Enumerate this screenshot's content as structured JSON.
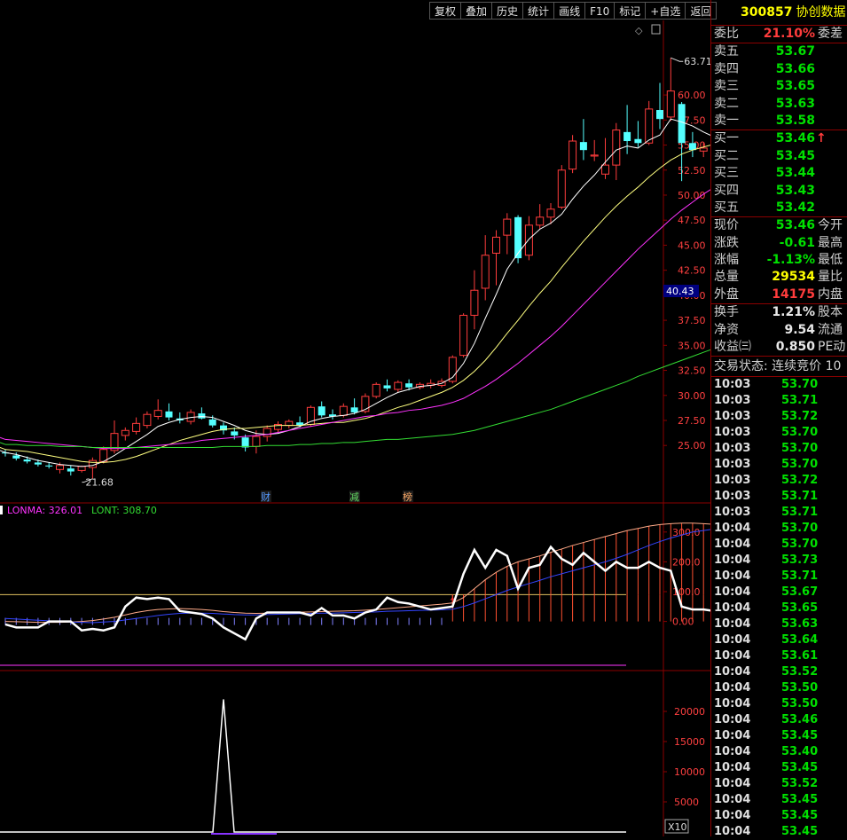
{
  "toolbar": [
    "复权",
    "叠加",
    "历史",
    "统计",
    "画线",
    "F10",
    "标记",
    "+自选",
    "返回"
  ],
  "stock": {
    "code": "300857",
    "name": "协创数据"
  },
  "order_ratio": {
    "label": "委比",
    "value": "21.10%",
    "label2": "委差"
  },
  "asks": [
    {
      "label": "卖五",
      "price": "53.67"
    },
    {
      "label": "卖四",
      "price": "53.66"
    },
    {
      "label": "卖三",
      "price": "53.65"
    },
    {
      "label": "卖二",
      "price": "53.63"
    },
    {
      "label": "卖一",
      "price": "53.58"
    }
  ],
  "bids": [
    {
      "label": "买一",
      "price": "53.46",
      "arrow": "↑"
    },
    {
      "label": "买二",
      "price": "53.45"
    },
    {
      "label": "买三",
      "price": "53.44"
    },
    {
      "label": "买四",
      "price": "53.43"
    },
    {
      "label": "买五",
      "price": "53.42"
    }
  ],
  "quote": [
    {
      "label": "现价",
      "value": "53.46",
      "label2": "今开",
      "color": "green"
    },
    {
      "label": "涨跌",
      "value": "-0.61",
      "label2": "最高",
      "color": "green"
    },
    {
      "label": "涨幅",
      "value": "-1.13%",
      "label2": "最低",
      "color": "green"
    },
    {
      "label": "总量",
      "value": "29534",
      "label2": "量比",
      "color": "yellow"
    },
    {
      "label": "外盘",
      "value": "14175",
      "label2": "内盘",
      "color": "red"
    }
  ],
  "fund": [
    {
      "label": "换手",
      "value": "1.21%",
      "label2": "股本"
    },
    {
      "label": "净资",
      "value": "9.54",
      "label2": "流通"
    },
    {
      "label": "收益㈢",
      "value": "0.850",
      "label2": "PE动"
    }
  ],
  "trade_status": "交易状态: 连续竞价 10",
  "ticks": [
    {
      "t": "10:03",
      "p": "53.70"
    },
    {
      "t": "10:03",
      "p": "53.71"
    },
    {
      "t": "10:03",
      "p": "53.72"
    },
    {
      "t": "10:03",
      "p": "53.70"
    },
    {
      "t": "10:03",
      "p": "53.70"
    },
    {
      "t": "10:03",
      "p": "53.70"
    },
    {
      "t": "10:03",
      "p": "53.72"
    },
    {
      "t": "10:03",
      "p": "53.71"
    },
    {
      "t": "10:03",
      "p": "53.71"
    },
    {
      "t": "10:04",
      "p": "53.70"
    },
    {
      "t": "10:04",
      "p": "53.70"
    },
    {
      "t": "10:04",
      "p": "53.73"
    },
    {
      "t": "10:04",
      "p": "53.71"
    },
    {
      "t": "10:04",
      "p": "53.67"
    },
    {
      "t": "10:04",
      "p": "53.65"
    },
    {
      "t": "10:04",
      "p": "53.63"
    },
    {
      "t": "10:04",
      "p": "53.64"
    },
    {
      "t": "10:04",
      "p": "53.61"
    },
    {
      "t": "10:04",
      "p": "53.52"
    },
    {
      "t": "10:04",
      "p": "53.50"
    },
    {
      "t": "10:04",
      "p": "53.50"
    },
    {
      "t": "10:04",
      "p": "53.46"
    },
    {
      "t": "10:04",
      "p": "53.45"
    },
    {
      "t": "10:04",
      "p": "53.40"
    },
    {
      "t": "10:04",
      "p": "53.45"
    },
    {
      "t": "10:04",
      "p": "53.52"
    },
    {
      "t": "10:04",
      "p": "53.45"
    },
    {
      "t": "10:04",
      "p": "53.45"
    },
    {
      "t": "10:04",
      "p": "53.45"
    }
  ],
  "chart_data": {
    "type": "candlestick",
    "price_axis": {
      "ticks": [
        25,
        27.5,
        30,
        32.5,
        35,
        37.5,
        40,
        42.5,
        45,
        47.5,
        50,
        52.5,
        55,
        57.5,
        60
      ],
      "labels": [
        "25.00",
        "27.50",
        "30.00",
        "32.50",
        "35.00",
        "37.50",
        "40.00",
        "42.50",
        "45.00",
        "47.50",
        "50.00",
        "52.50",
        "55.00",
        "57.50",
        "60.00"
      ],
      "range": [
        20.5,
        65.5
      ]
    },
    "crosshair_price": "40.43",
    "high_label": "63.71",
    "low_label": "21.68",
    "events": [
      "财",
      "减",
      "榜"
    ],
    "ohlc": [
      [
        24.3,
        24.6,
        23.9,
        24.2
      ],
      [
        24.0,
        24.3,
        23.5,
        23.7
      ],
      [
        23.6,
        23.9,
        23.2,
        23.4
      ],
      [
        23.3,
        23.6,
        22.9,
        23.1
      ],
      [
        23.0,
        23.3,
        22.7,
        22.9
      ],
      [
        22.6,
        23.3,
        22.2,
        23.0
      ],
      [
        22.7,
        23.0,
        22.0,
        22.4
      ],
      [
        22.5,
        23.0,
        22.3,
        22.9
      ],
      [
        22.8,
        23.8,
        21.68,
        23.5
      ],
      [
        23.4,
        24.9,
        23.2,
        24.6
      ],
      [
        24.5,
        27.5,
        24.2,
        26.2
      ],
      [
        26.0,
        26.8,
        25.5,
        26.5
      ],
      [
        26.4,
        27.8,
        26.1,
        27.2
      ],
      [
        27.0,
        28.4,
        26.7,
        28.1
      ],
      [
        27.9,
        29.6,
        27.6,
        28.5
      ],
      [
        28.4,
        29.2,
        27.5,
        27.8
      ],
      [
        27.7,
        28.3,
        27.2,
        27.5
      ],
      [
        27.4,
        28.6,
        27.1,
        28.3
      ],
      [
        28.2,
        28.8,
        27.6,
        27.7
      ],
      [
        27.6,
        28.0,
        26.8,
        27.0
      ],
      [
        27.0,
        27.3,
        26.1,
        26.5
      ],
      [
        26.4,
        26.8,
        25.6,
        26.0
      ],
      [
        25.8,
        26.1,
        24.4,
        24.8
      ],
      [
        24.9,
        26.5,
        24.2,
        25.9
      ],
      [
        25.9,
        27.0,
        25.4,
        26.7
      ],
      [
        26.6,
        27.4,
        26.3,
        27.1
      ],
      [
        27.0,
        27.6,
        26.7,
        27.4
      ],
      [
        27.3,
        27.9,
        26.8,
        27.0
      ],
      [
        27.1,
        29.0,
        26.9,
        28.8
      ],
      [
        28.9,
        29.4,
        27.8,
        28.0
      ],
      [
        28.1,
        28.6,
        27.6,
        27.9
      ],
      [
        28.0,
        29.2,
        27.8,
        28.9
      ],
      [
        28.8,
        29.7,
        28.1,
        28.3
      ],
      [
        28.4,
        30.2,
        28.2,
        29.9
      ],
      [
        29.9,
        31.3,
        29.7,
        31.1
      ],
      [
        31.0,
        31.6,
        30.4,
        30.7
      ],
      [
        30.6,
        31.5,
        30.3,
        31.3
      ],
      [
        31.2,
        31.6,
        30.5,
        30.8
      ],
      [
        30.8,
        31.3,
        30.6,
        31.1
      ],
      [
        31.0,
        31.6,
        30.7,
        31.2
      ],
      [
        31.0,
        31.7,
        30.8,
        31.4
      ],
      [
        31.4,
        34.0,
        31.2,
        33.8
      ],
      [
        34.0,
        38.2,
        33.8,
        38.0
      ],
      [
        38.0,
        42.5,
        36.6,
        40.5
      ],
      [
        40.7,
        46.0,
        39.5,
        44.0
      ],
      [
        44.2,
        46.5,
        41.0,
        45.8
      ],
      [
        46.0,
        48.2,
        44.1,
        47.6
      ],
      [
        47.8,
        48.0,
        43.2,
        43.7
      ],
      [
        44.0,
        47.9,
        43.5,
        47.0
      ],
      [
        47.0,
        49.1,
        46.6,
        47.8
      ],
      [
        47.8,
        49.2,
        47.1,
        48.6
      ],
      [
        48.8,
        53.0,
        48.6,
        52.5
      ],
      [
        52.6,
        56.0,
        52.2,
        55.4
      ],
      [
        55.3,
        57.6,
        53.5,
        54.5
      ],
      [
        53.9,
        55.5,
        53.4,
        54.0
      ],
      [
        52.1,
        55.7,
        51.6,
        53.0
      ],
      [
        53.0,
        57.2,
        51.5,
        56.5
      ],
      [
        56.3,
        59.0,
        54.1,
        55.4
      ],
      [
        55.6,
        57.4,
        54.8,
        55.2
      ],
      [
        55.2,
        59.4,
        55.0,
        58.6
      ],
      [
        58.5,
        61.2,
        56.6,
        57.6
      ],
      [
        57.8,
        63.71,
        57.4,
        60.4
      ],
      [
        59.1,
        59.3,
        51.4,
        55.2
      ],
      [
        55.2,
        56.3,
        53.8,
        54.5
      ],
      [
        54.4,
        55.2,
        53.8,
        54.7
      ],
      [
        54.6,
        55.6,
        53.9,
        54.4
      ],
      [
        54.4,
        57.4,
        53.9,
        54.0
      ],
      [
        54.9,
        55.8,
        53.0,
        53.46
      ]
    ],
    "ma_lines": [
      {
        "color": "#ffffff",
        "values": [
          24.3,
          24.1,
          23.8,
          23.5,
          23.3,
          23.1,
          23.0,
          22.9,
          23.0,
          23.4,
          24.0,
          24.7,
          25.4,
          26.1,
          26.9,
          27.3,
          27.6,
          27.8,
          27.9,
          27.8,
          27.4,
          27.0,
          26.5,
          26.2,
          26.1,
          26.2,
          26.5,
          26.9,
          27.4,
          27.7,
          27.9,
          28.0,
          28.2,
          28.6,
          29.2,
          29.8,
          30.3,
          30.6,
          30.9,
          31.0,
          31.2,
          31.8,
          33.2,
          35.2,
          37.7,
          40.1,
          42.6,
          44.2,
          45.6,
          46.6,
          47.2,
          48.1,
          49.6,
          50.9,
          52.0,
          53.3,
          54.5,
          54.9,
          54.7,
          55.5,
          56.0,
          57.6,
          57.3,
          56.9,
          56.3,
          55.8,
          55.1,
          54.4
        ]
      },
      {
        "color": "#ffff80",
        "values": [
          24.6,
          24.5,
          24.4,
          24.2,
          24.0,
          23.8,
          23.6,
          23.4,
          23.3,
          23.3,
          23.4,
          23.6,
          23.9,
          24.3,
          24.7,
          25.1,
          25.5,
          25.8,
          26.1,
          26.4,
          26.6,
          26.7,
          26.7,
          26.8,
          26.9,
          27.0,
          27.0,
          27.0,
          27.1,
          27.2,
          27.3,
          27.3,
          27.5,
          27.7,
          28.0,
          28.4,
          28.8,
          29.1,
          29.5,
          29.9,
          30.3,
          30.8,
          31.5,
          32.4,
          33.5,
          34.8,
          36.2,
          37.5,
          38.9,
          40.2,
          41.4,
          42.8,
          44.1,
          45.4,
          46.6,
          47.8,
          48.9,
          49.9,
          50.8,
          51.8,
          52.7,
          53.5,
          54.1,
          54.5,
          54.8,
          55.1,
          55.2,
          55.2
        ]
      },
      {
        "color": "#ff33ff",
        "values": [
          25.6,
          25.5,
          25.4,
          25.3,
          25.2,
          25.1,
          25.0,
          24.9,
          24.8,
          24.7,
          24.7,
          24.7,
          24.8,
          24.9,
          25.0,
          25.1,
          25.2,
          25.3,
          25.5,
          25.6,
          25.7,
          25.8,
          25.9,
          26.0,
          26.1,
          26.3,
          26.5,
          26.7,
          26.9,
          27.1,
          27.3,
          27.5,
          27.7,
          27.9,
          28.0,
          28.2,
          28.3,
          28.5,
          28.6,
          28.8,
          29.0,
          29.3,
          29.7,
          30.3,
          30.9,
          31.6,
          32.4,
          33.2,
          34.1,
          35.0,
          35.9,
          36.9,
          38.0,
          39.1,
          40.2,
          41.3,
          42.4,
          43.5,
          44.6,
          45.6,
          46.6,
          47.6,
          48.5,
          49.3,
          50.1,
          50.8,
          51.5,
          52.1
        ]
      },
      {
        "color": "#33dd33",
        "values": [
          25.1,
          25.1,
          25.0,
          25.0,
          25.0,
          24.9,
          24.9,
          24.9,
          24.8,
          24.8,
          24.8,
          24.8,
          24.8,
          24.8,
          24.8,
          24.8,
          24.8,
          24.8,
          24.8,
          24.8,
          24.9,
          24.9,
          24.9,
          24.9,
          25.0,
          25.0,
          25.0,
          25.1,
          25.1,
          25.2,
          25.2,
          25.3,
          25.3,
          25.4,
          25.5,
          25.6,
          25.6,
          25.7,
          25.8,
          25.9,
          26.0,
          26.1,
          26.3,
          26.5,
          26.8,
          27.1,
          27.4,
          27.7,
          28.0,
          28.3,
          28.6,
          29.0,
          29.4,
          29.8,
          30.2,
          30.6,
          31.0,
          31.4,
          31.9,
          32.3,
          32.7,
          33.1,
          33.5,
          33.9,
          34.3,
          34.7,
          35.1,
          35.4
        ]
      }
    ],
    "indicator": {
      "legend": [
        {
          "text": "LONMA: 326.01",
          "color": "#ff33ff"
        },
        {
          "text": "LONT: 308.70",
          "color": "#33dd33"
        }
      ],
      "axis_ticks": [
        0,
        100,
        200,
        300
      ],
      "axis_labels": [
        "0.00",
        "100.0",
        "200.0",
        "300.0"
      ],
      "range": [
        -150,
        350
      ],
      "threshold": 90,
      "white": [
        -10,
        -20,
        -20,
        -20,
        0,
        0,
        0,
        -30,
        -25,
        -30,
        -20,
        50,
        80,
        75,
        80,
        75,
        35,
        30,
        25,
        10,
        -20,
        -40,
        -60,
        10,
        30,
        30,
        30,
        30,
        20,
        45,
        20,
        20,
        10,
        30,
        40,
        80,
        65,
        60,
        50,
        40,
        45,
        50,
        160,
        240,
        180,
        240,
        220,
        110,
        180,
        190,
        250,
        210,
        190,
        230,
        200,
        170,
        200,
        180,
        180,
        200,
        180,
        170,
        50,
        40,
        40,
        35,
        30,
        20
      ],
      "blue": [
        10,
        8,
        6,
        4,
        2,
        0,
        -2,
        -3,
        -4,
        -2,
        0,
        5,
        10,
        15,
        20,
        24,
        27,
        28,
        28,
        27,
        25,
        23,
        22,
        22,
        23,
        24,
        25,
        26,
        27,
        28,
        28,
        29,
        30,
        31,
        32,
        34,
        35,
        36,
        37,
        38,
        39,
        41,
        50,
        62,
        76,
        90,
        104,
        116,
        127,
        138,
        150,
        160,
        170,
        180,
        190,
        200,
        212,
        225,
        240,
        255,
        268,
        280,
        290,
        300,
        305,
        310,
        313,
        315
      ],
      "pink": [
        0,
        -1,
        -2,
        -3,
        -3,
        -3,
        -2,
        0,
        3,
        8,
        14,
        22,
        30,
        36,
        40,
        42,
        43,
        42,
        40,
        37,
        33,
        30,
        28,
        27,
        28,
        29,
        30,
        31,
        32,
        33,
        34,
        35,
        36,
        38,
        40,
        43,
        46,
        49,
        52,
        55,
        58,
        62,
        80,
        110,
        140,
        165,
        185,
        200,
        210,
        220,
        232,
        243,
        255,
        265,
        275,
        285,
        295,
        305,
        312,
        320,
        325,
        328,
        330,
        330,
        328,
        326,
        324,
        320
      ],
      "bars_from": 41
    },
    "volume": {
      "axis_ticks": [
        5000,
        10000,
        15000,
        20000
      ],
      "axis_labels": [
        "5000",
        "10000",
        "15000",
        "20000"
      ],
      "range": [
        0,
        25000
      ],
      "spike_index": 20,
      "spike_value": 22000,
      "unit_label": "X10"
    }
  }
}
